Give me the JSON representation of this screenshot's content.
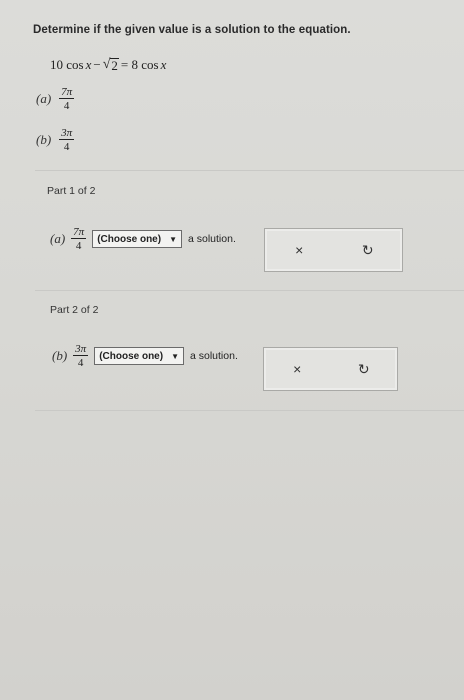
{
  "question": "Determine if the given value is a solution to the equation.",
  "equation": {
    "left_coef": "10 cos",
    "left_var": "x",
    "minus": "−",
    "radicand": "2",
    "equals": "= 8 cos",
    "right_var": "x"
  },
  "options": [
    {
      "label": "(a)",
      "numerator": "7π",
      "denominator": "4"
    },
    {
      "label": "(b)",
      "numerator": "3π",
      "denominator": "4"
    }
  ],
  "parts": [
    {
      "title": "Part 1 of 2",
      "label": "(a)",
      "numerator": "7π",
      "denominator": "4",
      "select_value": "(Choose one)",
      "suffix": "a solution."
    },
    {
      "title": "Part 2 of 2",
      "label": "(b)",
      "numerator": "3π",
      "denominator": "4",
      "select_value": "(Choose one)",
      "suffix": "a solution."
    }
  ],
  "icons": {
    "close": "×",
    "reset": "↻",
    "dropdown": "▼"
  }
}
